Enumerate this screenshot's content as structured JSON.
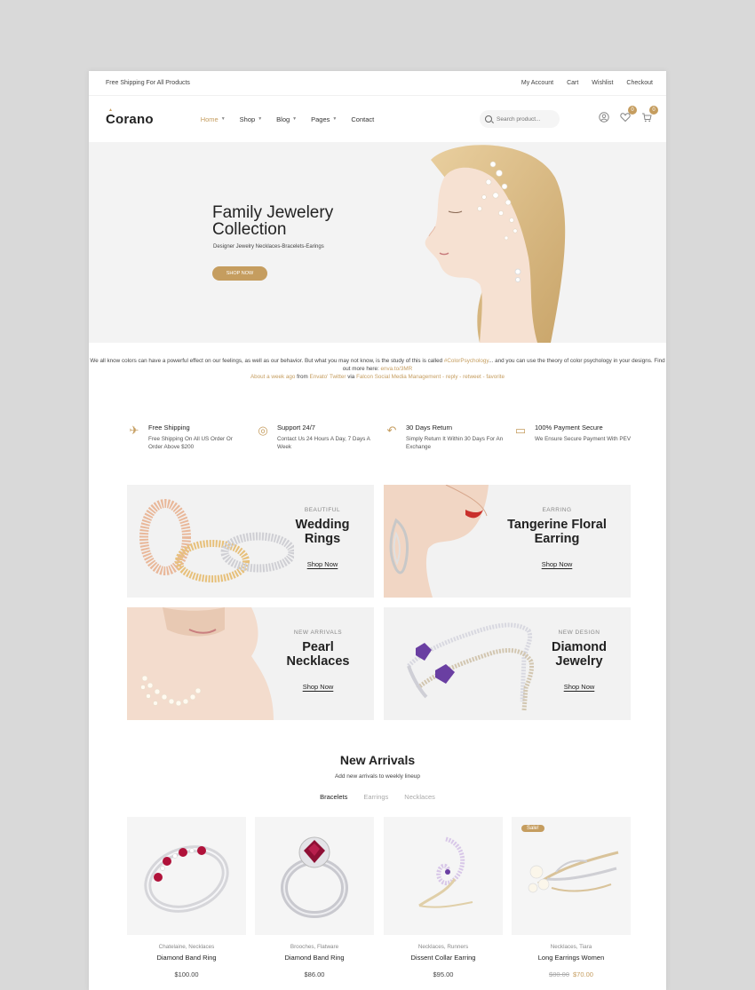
{
  "topbar": {
    "shipping_notice": "Free Shipping For All Products",
    "links": [
      "My Account",
      "Cart",
      "Wishlist",
      "Checkout"
    ]
  },
  "header": {
    "logo": "Corano",
    "nav": [
      {
        "label": "Home",
        "has_dropdown": true,
        "active": true
      },
      {
        "label": "Shop",
        "has_dropdown": true,
        "active": false
      },
      {
        "label": "Blog",
        "has_dropdown": true,
        "active": false
      },
      {
        "label": "Pages",
        "has_dropdown": true,
        "active": false
      },
      {
        "label": "Contact",
        "has_dropdown": false,
        "active": false
      }
    ],
    "search_placeholder": "Search product...",
    "wishlist_count": "0",
    "cart_count": "0"
  },
  "hero": {
    "title": "Family Jewelery Collection",
    "subtitle": "Designer Jewelry Necklaces-Bracelets-Earings",
    "button": "SHOP NOW"
  },
  "tweet": {
    "text": "We all know colors can have a powerful effect on our feelings, as well as our behavior. But what you may not know, is the study of this is called",
    "hashtag": "#ColorPsychology",
    "text2": "... and you can use the theory of color psychology in your designs. Find out more here:",
    "link": "enva.to/3MR",
    "time": "About a week ago",
    "from_word": "from",
    "source": "Envato' Twitter",
    "via_word": "via",
    "via": "Falcon Social Media Management",
    "actions": "- reply - retweet - favorite"
  },
  "services": [
    {
      "icon": "plane-icon",
      "title": "Free Shipping",
      "text": "Free Shipping On All US Order Or Order Above $200"
    },
    {
      "icon": "support-icon",
      "title": "Support 24/7",
      "text": "Contact Us 24 Hours A Day, 7 Days A Week"
    },
    {
      "icon": "return-icon",
      "title": "30 Days Return",
      "text": "Simply Return It Within 30 Days For An Exchange"
    },
    {
      "icon": "card-icon",
      "title": "100% Payment Secure",
      "text": "We Ensure Secure Payment With PEV"
    }
  ],
  "banners": [
    {
      "small": "BEAUTIFUL",
      "title": "Wedding Rings",
      "link": "Shop Now"
    },
    {
      "small": "EARRING",
      "title": "Tangerine Floral Earring",
      "link": "Shop Now"
    },
    {
      "small": "NEW ARRIVALS",
      "title": "Pearl Necklaces",
      "link": "Shop Now"
    },
    {
      "small": "NEW DESIGN",
      "title": "Diamond Jewelry",
      "link": "Shop Now"
    }
  ],
  "new_arrivals": {
    "title": "New Arrivals",
    "subtitle": "Add new arrivals to weekly lineup",
    "tabs": [
      {
        "label": "Bracelets",
        "active": true
      },
      {
        "label": "Earrings",
        "active": false
      },
      {
        "label": "Necklaces",
        "active": false
      }
    ]
  },
  "products": [
    {
      "cats": "Chatelaine, Necklaces",
      "name": "Diamond Band Ring",
      "price": "$100.00",
      "old_price": "",
      "sale": ""
    },
    {
      "cats": "Brooches, Flatware",
      "name": "Diamond Band Ring",
      "price": "$86.00",
      "old_price": "",
      "sale": ""
    },
    {
      "cats": "Necklaces, Runners",
      "name": "Dissent Collar Earring",
      "price": "$95.00",
      "old_price": "",
      "sale": ""
    },
    {
      "cats": "Necklaces, Tiara",
      "name": "Long Earrings Women",
      "price": "$70.00",
      "old_price": "$80.00",
      "sale": "Sale!"
    }
  ],
  "colors": {
    "accent": "#c59d5f",
    "banner_bg": "#f2f2f2",
    "hero_bg": "#f3f3f3"
  }
}
